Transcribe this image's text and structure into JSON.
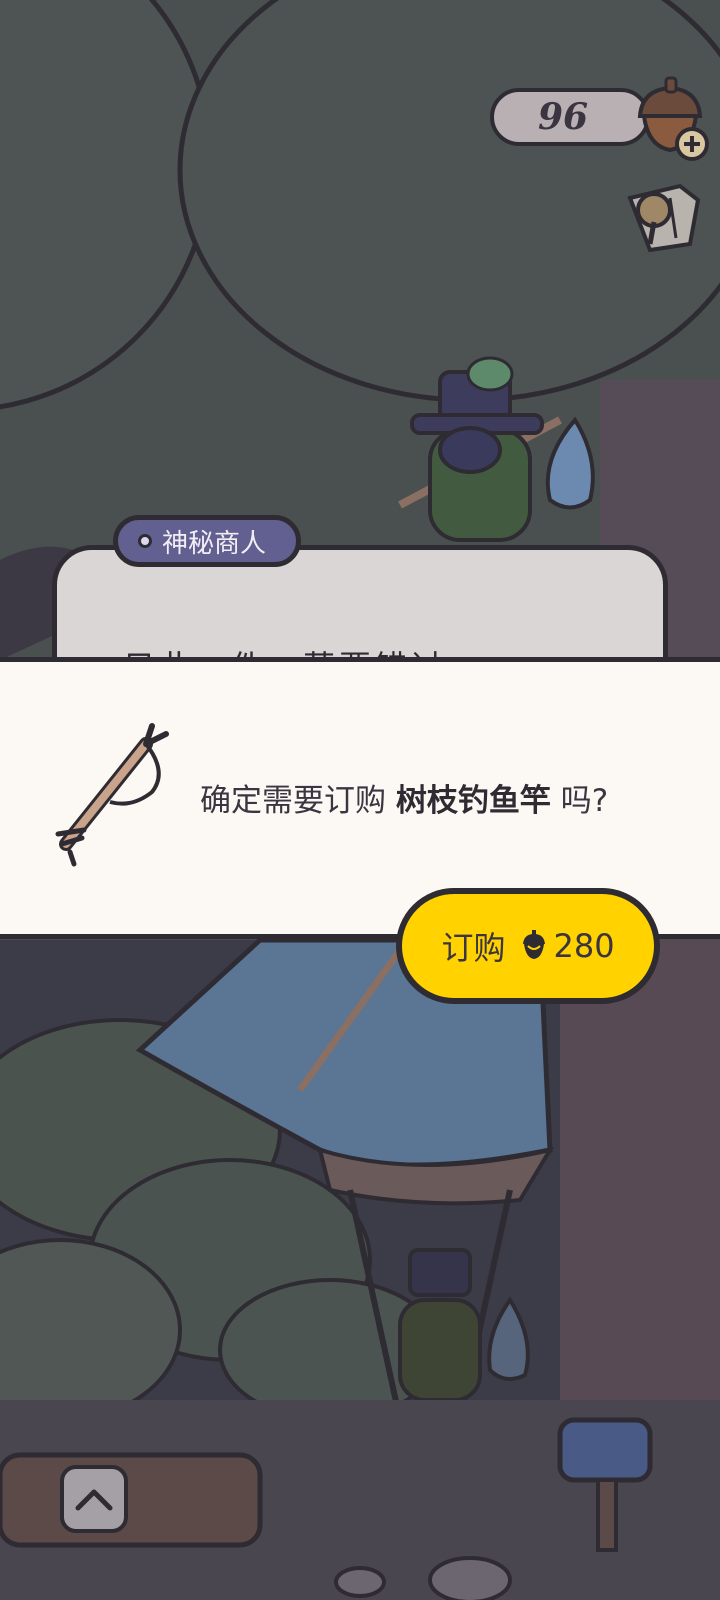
{
  "hud": {
    "currency_value": "96",
    "acorn_icon": "acorn-plus-icon",
    "map_icon": "map-icon"
  },
  "dialog": {
    "speaker": "神秘商人",
    "partial_text": "只此一件，莫要错过"
  },
  "confirm": {
    "prefix": "确定需要订购 ",
    "item_name": "树枝钓鱼竿",
    "suffix": " 吗?",
    "item_icon": "branch-fishing-rod-icon"
  },
  "buy_button": {
    "label": "订购",
    "price": "280",
    "currency_icon": "acorn-icon"
  },
  "nav": {
    "up_icon": "chevron-up-icon"
  },
  "colors": {
    "accent_yellow": "#ffd200",
    "tag_purple": "#626090",
    "outline": "#2f2b33",
    "panel": "#fcf9f5"
  }
}
